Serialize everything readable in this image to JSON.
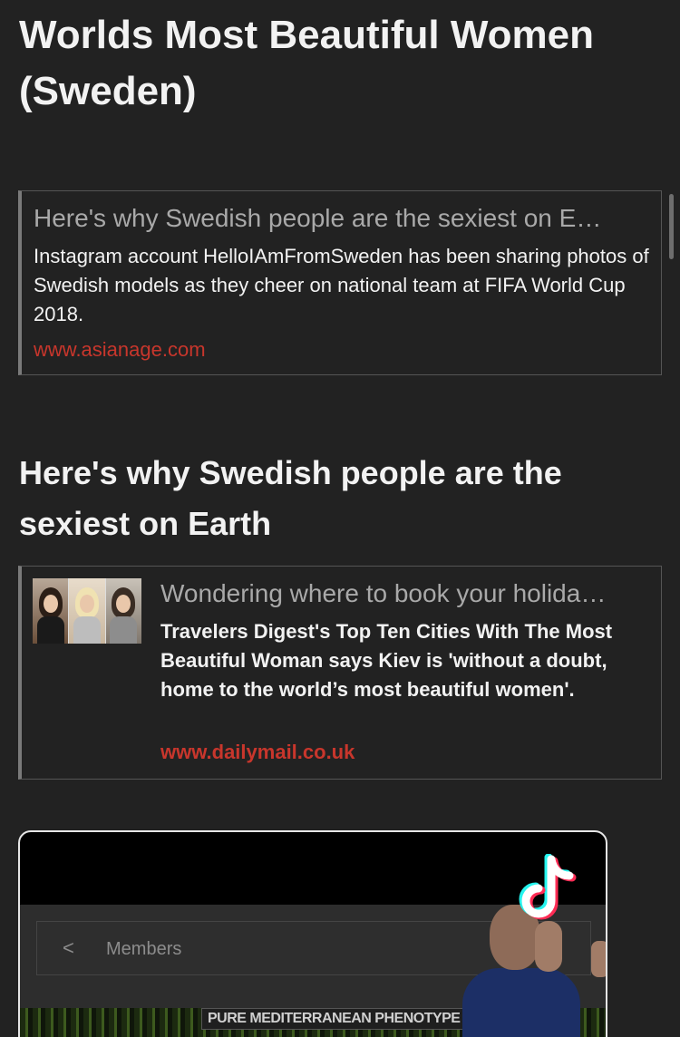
{
  "page": {
    "title": "Worlds Most Beautiful Women (Sweden)",
    "section_heading": "Here's why Swedish people are the sexiest on Earth"
  },
  "cards": [
    {
      "title": "Here's why Swedish people are the sexiest on E…",
      "description": "Instagram account HelloIAmFromSweden has been sharing photos of Swedish models as they cheer on national team at FIFA World Cup 2018.",
      "link": "www.asianage.com"
    },
    {
      "title": "Wondering where to book your holida…",
      "description": "Travelers Digest's Top Ten Cities With The Most Beautiful Woman says Kiev is 'without a doubt, home to the world’s most beautiful women'.",
      "link": "www.dailymail.co.uk",
      "thumbnail_icon": "photo-collage-thumbnail"
    }
  ],
  "video": {
    "back_glyph": "<",
    "members_label": "Members",
    "caption": "PURE MEDITERRANEAN PHENOTYPE",
    "logo_icon": "tiktok-logo-icon"
  },
  "colors": {
    "background": "#222222",
    "link": "#c8362c",
    "card_title": "#a9a9a9"
  }
}
